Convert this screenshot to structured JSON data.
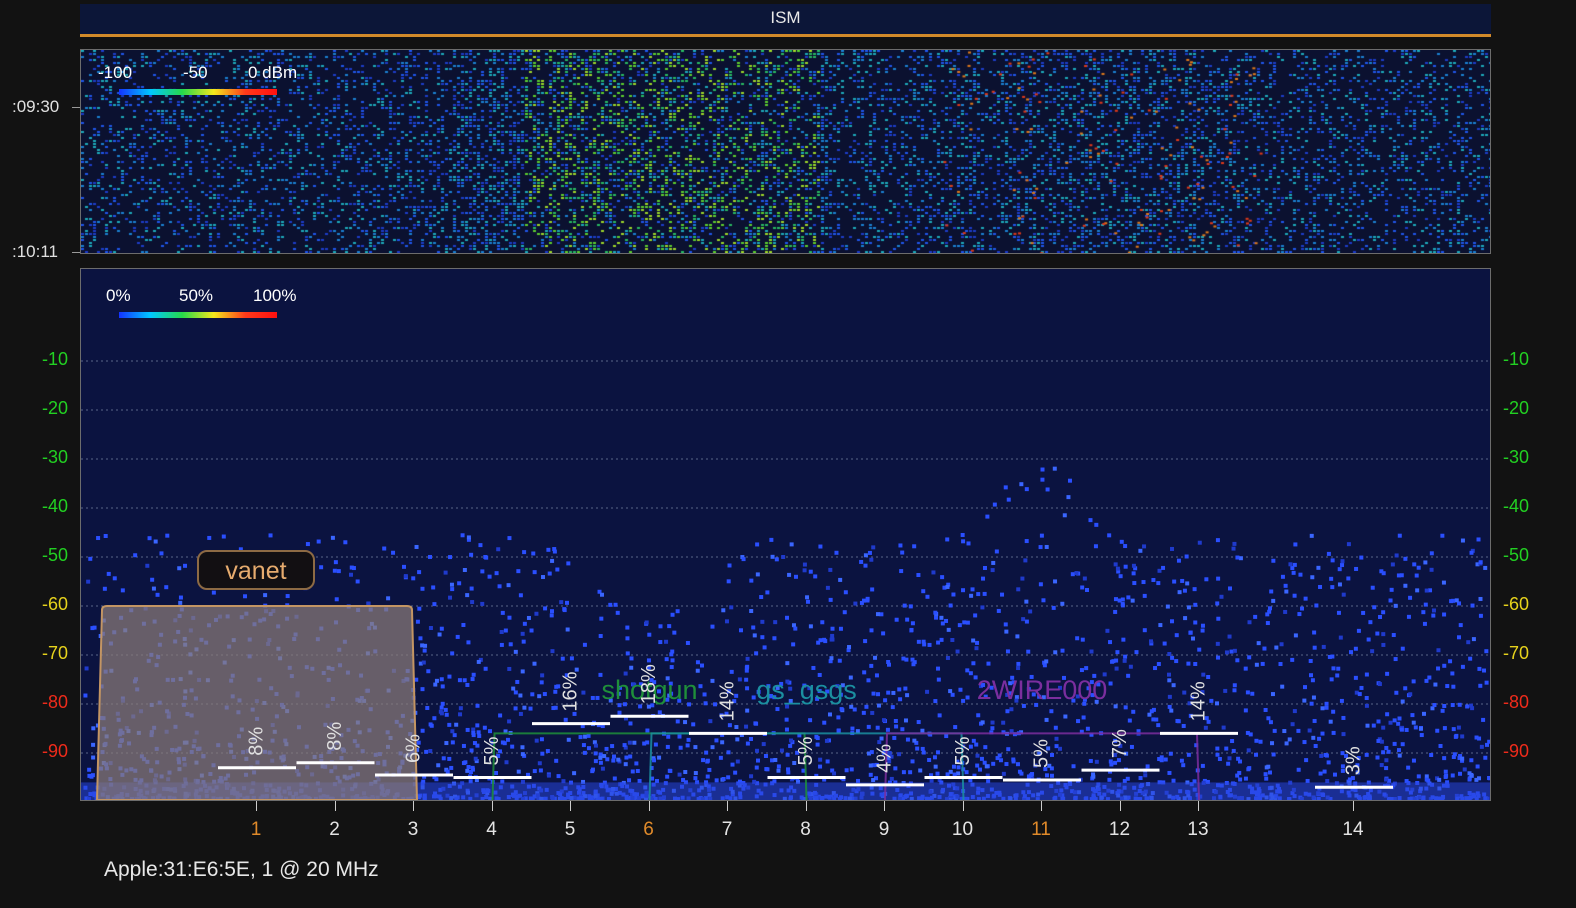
{
  "header": {
    "band_name": "ISM"
  },
  "waterfall": {
    "legend_labels": [
      "-100",
      "-50",
      "0 dBm"
    ],
    "time_labels": [
      ":09:30",
      ":10:11"
    ]
  },
  "spectrum": {
    "legend_labels": [
      "0%",
      "50%",
      "100%"
    ]
  },
  "status": {
    "device": "Apple:31:E6:5E, 1 @ 20 MHz"
  },
  "network_badge": {
    "label": "vanet"
  },
  "colors": {
    "orange_channel": "#e08a2a",
    "white_channel": "#e4e4e4",
    "y_green": "#22d022",
    "y_yellow": "#e6d21c",
    "y_red": "#ee2b1b",
    "density_blue": "#2a4fff",
    "highlight_fill": "#8a7b78",
    "highlight_stroke": "#c39563"
  },
  "chart_data": {
    "type": "heatmap",
    "title": "",
    "xlabel": "",
    "ylabel": "",
    "x_ticks": [
      {
        "label": "1",
        "channel": 1,
        "color": "orange"
      },
      {
        "label": "2",
        "channel": 2,
        "color": "white"
      },
      {
        "label": "3",
        "channel": 3,
        "color": "white"
      },
      {
        "label": "4",
        "channel": 4,
        "color": "white"
      },
      {
        "label": "5",
        "channel": 5,
        "color": "white"
      },
      {
        "label": "6",
        "channel": 6,
        "color": "orange"
      },
      {
        "label": "7",
        "channel": 7,
        "color": "white"
      },
      {
        "label": "8",
        "channel": 8,
        "color": "white"
      },
      {
        "label": "9",
        "channel": 9,
        "color": "white"
      },
      {
        "label": "10",
        "channel": 10,
        "color": "white"
      },
      {
        "label": "11",
        "channel": 11,
        "color": "orange"
      },
      {
        "label": "12",
        "channel": 12,
        "color": "white"
      },
      {
        "label": "13",
        "channel": 13,
        "color": "white"
      },
      {
        "label": "14",
        "channel": 14,
        "color": "white"
      }
    ],
    "y_ticks": [
      {
        "label": "-10",
        "value": -10,
        "color": "green"
      },
      {
        "label": "-20",
        "value": -20,
        "color": "green"
      },
      {
        "label": "-30",
        "value": -30,
        "color": "green"
      },
      {
        "label": "-40",
        "value": -40,
        "color": "green"
      },
      {
        "label": "-50",
        "value": -50,
        "color": "green"
      },
      {
        "label": "-60",
        "value": -60,
        "color": "yellow"
      },
      {
        "label": "-70",
        "value": -70,
        "color": "yellow"
      },
      {
        "label": "-80",
        "value": -80,
        "color": "red"
      },
      {
        "label": "-90",
        "value": -90,
        "color": "red"
      }
    ],
    "ylim": [
      -100,
      0
    ],
    "grid": true,
    "channel_utilization": [
      {
        "channel": 1,
        "value": 8,
        "label": "8%",
        "level_dbm": -93
      },
      {
        "channel": 2,
        "value": 8,
        "label": "8%",
        "level_dbm": -92
      },
      {
        "channel": 3,
        "value": 6,
        "label": "6%",
        "level_dbm": -94.5
      },
      {
        "channel": 4,
        "value": 5,
        "label": "5%",
        "level_dbm": -95
      },
      {
        "channel": 5,
        "value": 16,
        "label": "16%",
        "level_dbm": -84
      },
      {
        "channel": 6,
        "value": 18,
        "label": "18%",
        "level_dbm": -82.5
      },
      {
        "channel": 7,
        "value": 14,
        "label": "14%",
        "level_dbm": -86
      },
      {
        "channel": 8,
        "value": 5,
        "label": "5%",
        "level_dbm": -95
      },
      {
        "channel": 9,
        "value": 4,
        "label": "4%",
        "level_dbm": -96.5
      },
      {
        "channel": 10,
        "value": 5,
        "label": "5%",
        "level_dbm": -95
      },
      {
        "channel": 11,
        "value": 5,
        "label": "5%",
        "level_dbm": -95.5
      },
      {
        "channel": 12,
        "value": 7,
        "label": "7%",
        "level_dbm": -93.5
      },
      {
        "channel": 13,
        "value": 14,
        "label": "14%",
        "level_dbm": -86
      },
      {
        "channel": 14,
        "value": 3,
        "label": "3%",
        "level_dbm": -97
      }
    ],
    "networks": [
      {
        "name": "vanet",
        "channel": 1,
        "level_dbm": -60,
        "highlighted": true
      },
      {
        "name": "shotgun",
        "channel": 6,
        "level_dbm": -86,
        "color": "#1f8f3a"
      },
      {
        "name": "gs_gsgs",
        "channel": 8,
        "level_dbm": -86,
        "color": "#1b8fa0"
      },
      {
        "name": "2WIRE000",
        "channel": 11,
        "level_dbm": -86,
        "color": "#7b2e9e"
      }
    ]
  }
}
